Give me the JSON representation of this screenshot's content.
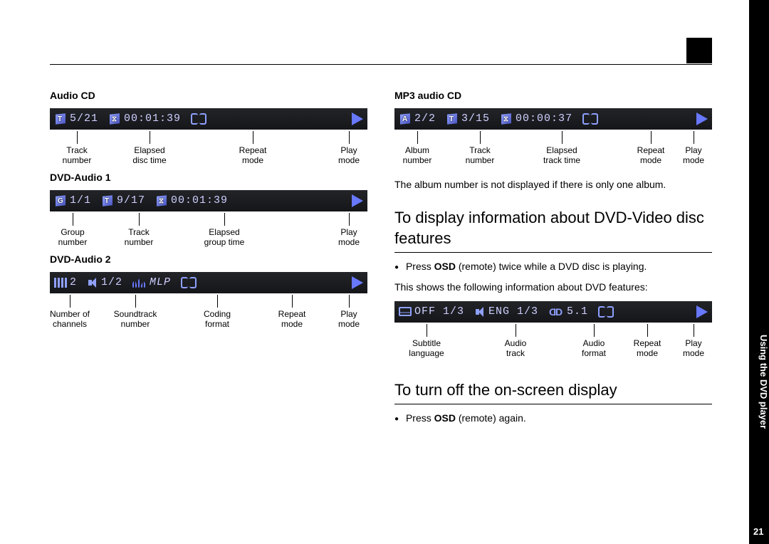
{
  "side_tab": "Using the DVD player",
  "page_number": "21",
  "left": {
    "audio_cd": {
      "title": "Audio CD",
      "track": "5/21",
      "time": "00:01:39",
      "labels": [
        "Track\nnumber",
        "Elapsed\ndisc time",
        "Repeat\nmode",
        "Play\nmode"
      ]
    },
    "dvd_a1": {
      "title": "DVD-Audio 1",
      "group": "1/1",
      "track": "9/17",
      "time": "00:01:39",
      "labels": [
        "Group\nnumber",
        "Track\nnumber",
        "Elapsed\ngroup time",
        "Play\nmode"
      ]
    },
    "dvd_a2": {
      "title": "DVD-Audio 2",
      "channels": "2",
      "soundtrack": "1/2",
      "coding": "MLP",
      "labels": [
        "Number of\nchannels",
        "Soundtrack\nnumber",
        "Coding\nformat",
        "Repeat\nmode",
        "Play\nmode"
      ]
    }
  },
  "right": {
    "mp3": {
      "title": "MP3 audio CD",
      "album": "2/2",
      "track": "3/15",
      "time": "00:00:37",
      "labels": [
        "Album\nnumber",
        "Track\nnumber",
        "Elapsed\ntrack time",
        "Repeat\nmode",
        "Play\nmode"
      ]
    },
    "mp3_note": "The album number is not displayed if there is only one album.",
    "h_features": "To display information about DVD-Video disc features",
    "press_osd_twice_pre": "Press ",
    "press_osd_twice_mid": "OSD",
    "press_osd_twice_post": " (remote) twice while a DVD disc is playing.",
    "features_line": "This shows the following information about DVD features:",
    "feat_bar": {
      "subtitle": "OFF 1/3",
      "audio": "ENG 1/3",
      "fmt": "5.1",
      "labels": [
        "Subtitle\nlanguage",
        "Audio\ntrack",
        "Audio\nformat",
        "Repeat\nmode",
        "Play\nmode"
      ]
    },
    "h_turnoff": "To turn off the on-screen display",
    "press_osd_again_pre": "Press ",
    "press_osd_again_mid": "OSD",
    "press_osd_again_post": " (remote) again."
  }
}
